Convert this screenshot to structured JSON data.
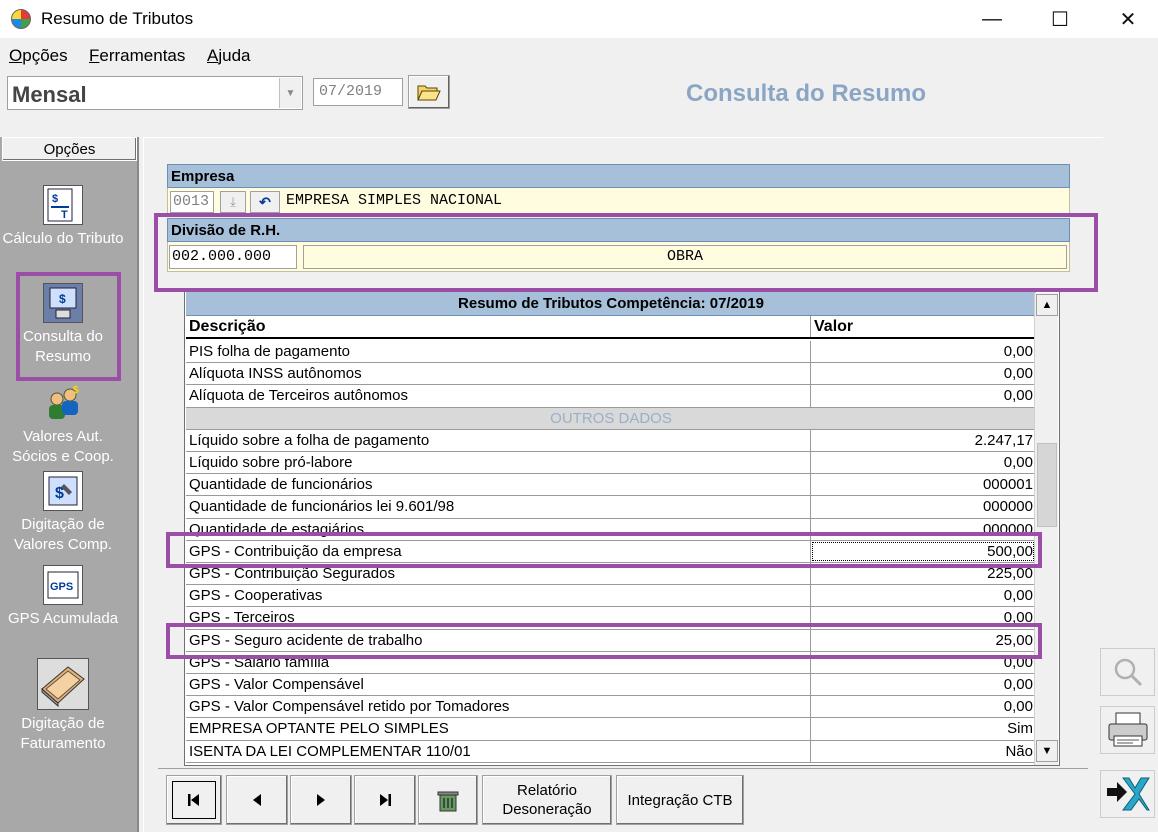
{
  "window": {
    "title": "Resumo de Tributos",
    "minimize": "—",
    "maximize": "☐",
    "close": "✕"
  },
  "menu": [
    {
      "label": "Opções",
      "underline": "O"
    },
    {
      "label": "Ferramentas",
      "underline": "F"
    },
    {
      "label": "Ajuda",
      "underline": "A"
    }
  ],
  "toolbar": {
    "period_type": "Mensal",
    "competencia": "07/2019",
    "panel_title": "Consulta do Resumo"
  },
  "sidebar": {
    "header": "Opções",
    "items": [
      {
        "label": "Cálculo do Tributo",
        "icon": "calculator-doc-icon"
      },
      {
        "label": "Consulta do Resumo",
        "icon": "computer-money-icon"
      },
      {
        "label": "Valores Aut. Sócios e Coop.",
        "icon": "people-money-icon"
      },
      {
        "label": "Digitação de Valores Comp.",
        "icon": "money-doc-icon"
      },
      {
        "label": "GPS Acumulada",
        "icon": "gps-doc-icon"
      },
      {
        "label": "Digitação de Faturamento",
        "icon": "keyboard-icon"
      }
    ]
  },
  "empresa": {
    "header": "Empresa",
    "code": "0013",
    "name": "EMPRESA SIMPLES NACIONAL"
  },
  "divisao": {
    "header": "Divisão de R.H.",
    "code": "002.000.000",
    "name": "OBRA"
  },
  "grid": {
    "title": "Resumo de Tributos Competência: 07/2019",
    "col_desc": "Descrição",
    "col_val": "Valor",
    "rows": [
      {
        "desc": "PIS folha de pagamento",
        "val": "0,00"
      },
      {
        "desc": "Alíquota INSS autônomos",
        "val": "0,00"
      },
      {
        "desc": "Alíquota de Terceiros autônomos",
        "val": "0,00"
      },
      {
        "desc": "OUTROS DADOS",
        "val": "",
        "section": true
      },
      {
        "desc": "Líquido sobre a folha de pagamento",
        "val": "2.247,17"
      },
      {
        "desc": "Líquido sobre pró-labore",
        "val": "0,00"
      },
      {
        "desc": "Quantidade de funcionários",
        "val": "000001"
      },
      {
        "desc": "Quantidade de funcionários lei 9.601/98",
        "val": "000000"
      },
      {
        "desc": "Quantidade de estagiários",
        "val": "000000"
      },
      {
        "desc": "GPS - Contribuição da empresa",
        "val": "500,00"
      },
      {
        "desc": "GPS - Contribuição Segurados",
        "val": "225,00"
      },
      {
        "desc": "GPS - Cooperativas",
        "val": "0,00"
      },
      {
        "desc": "GPS - Terceiros",
        "val": "0,00"
      },
      {
        "desc": "GPS - Seguro acidente de trabalho",
        "val": "25,00"
      },
      {
        "desc": "GPS - Salário família",
        "val": "0,00"
      },
      {
        "desc": "GPS - Valor Compensável",
        "val": "0,00"
      },
      {
        "desc": "GPS - Valor Compensável retido por Tomadores",
        "val": "0,00"
      },
      {
        "desc": "EMPRESA OPTANTE PELO SIMPLES",
        "val": "Sim"
      },
      {
        "desc": "ISENTA DA LEI COMPLEMENTAR 110/01",
        "val": "Não"
      }
    ]
  },
  "nav": {
    "first": "⏮",
    "prev": "◀",
    "next": "▶",
    "last": "⏭",
    "relatorio_line1": "Relatório",
    "relatorio_line2": "Desoneração",
    "integracao": "Integração CTB"
  },
  "colors": {
    "highlight": "#9b4ea5",
    "header_blue": "#a6c0da",
    "field_yellow": "#fffce0",
    "panel_title": "#8aa6c4"
  }
}
